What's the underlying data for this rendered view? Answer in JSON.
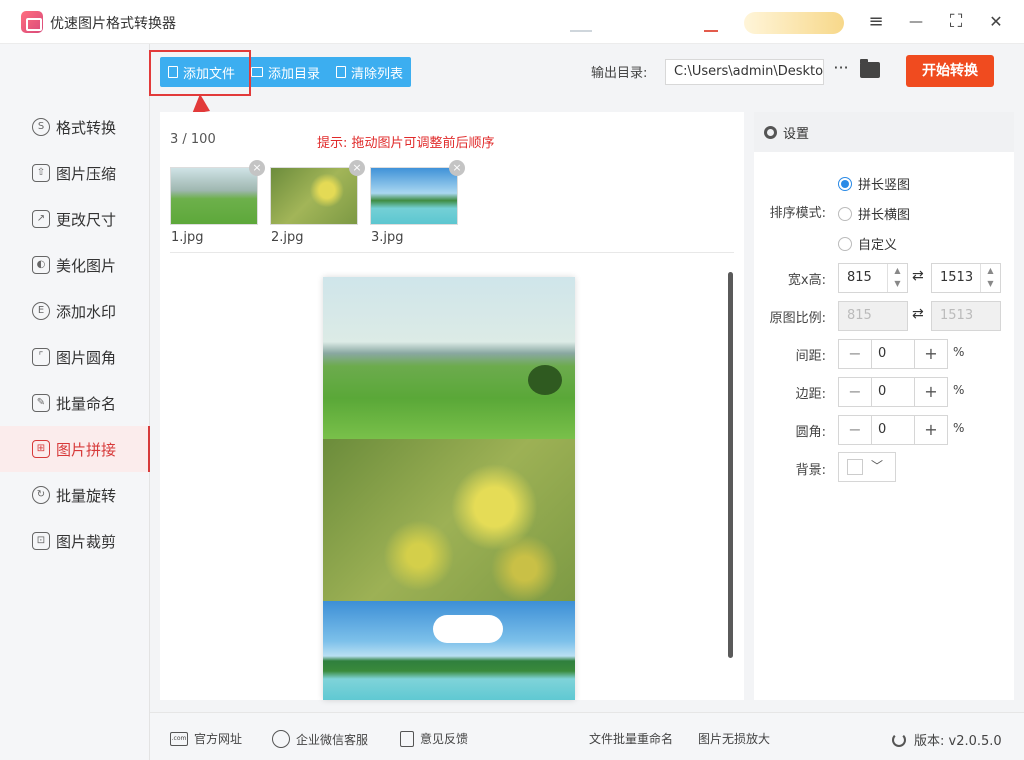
{
  "app": {
    "title": "优速图片格式转换器"
  },
  "window": {
    "menu": "≡",
    "minimize": "—",
    "maximize": "⛶",
    "close": "✕"
  },
  "nav": {
    "items": [
      {
        "label": "格式转换",
        "icon": "S"
      },
      {
        "label": "图片压缩",
        "icon": "⇧"
      },
      {
        "label": "更改尺寸",
        "icon": "↗"
      },
      {
        "label": "美化图片",
        "icon": "◐"
      },
      {
        "label": "添加水印",
        "icon": "E"
      },
      {
        "label": "图片圆角",
        "icon": "⌜"
      },
      {
        "label": "批量命名",
        "icon": "✎"
      },
      {
        "label": "图片拼接",
        "icon": "⊞",
        "active": true
      },
      {
        "label": "批量旋转",
        "icon": "↻"
      },
      {
        "label": "图片裁剪",
        "icon": "⊡"
      }
    ]
  },
  "toolbar": {
    "add_file": "添加文件",
    "add_dir": "添加目录",
    "clear_list": "清除列表",
    "output_label": "输出目录:",
    "output_path": "C:\\Users\\admin\\Deskto",
    "more": "···",
    "start": "开始转换"
  },
  "list": {
    "counter": "3 / 100",
    "hint": "提示: 拖动图片可调整前后顺序",
    "close_symbol": "×",
    "files": [
      {
        "name": "1.jpg"
      },
      {
        "name": "2.jpg"
      },
      {
        "name": "3.jpg"
      }
    ]
  },
  "settings": {
    "header": "设置",
    "sort_label": "排序模式:",
    "sort_options": [
      "拼长竖图",
      "拼长横图",
      "自定义"
    ],
    "sort_selected": "拼长竖图",
    "size_label": "宽x高:",
    "width": "815",
    "height": "1513",
    "ratio_label": "原图比例:",
    "ratio_w": "815",
    "ratio_h": "1513",
    "swap": "⇄",
    "spacing_label": "间距:",
    "spacing": "0",
    "margin_label": "边距:",
    "margin": "0",
    "corner_label": "圆角:",
    "corner": "0",
    "minus": "−",
    "plus": "+",
    "unit": "%",
    "bg_label": "背景:",
    "bg_color": "#ffffff"
  },
  "footer": {
    "website": "官方网址",
    "wechat": "企业微信客服",
    "feedback": "意见反馈",
    "batch_rename": "文件批量重命名",
    "lossless": "图片无损放大",
    "version": "版本: v2.0.5.0"
  },
  "colors": {
    "accent_blue": "#3caef0",
    "accent_red": "#d73a3a",
    "start_orange": "#f04b1f"
  }
}
